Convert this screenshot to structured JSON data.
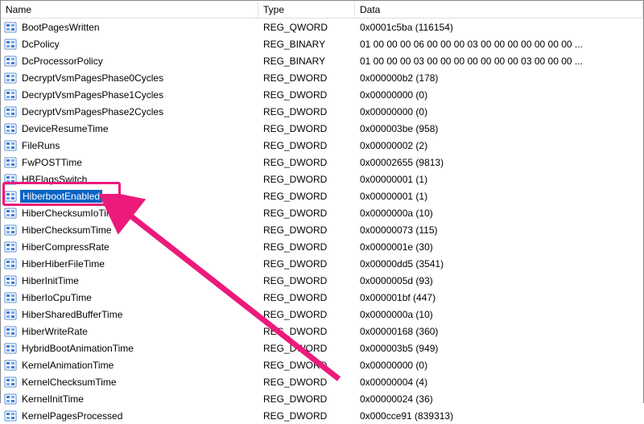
{
  "columns": {
    "name": "Name",
    "type": "Type",
    "data": "Data"
  },
  "rows": [
    {
      "name": "BootPagesWritten",
      "type": "REG_QWORD",
      "data": "0x0001c5ba (116154)"
    },
    {
      "name": "DcPolicy",
      "type": "REG_BINARY",
      "data": "01 00 00 00 06 00 00 00 03 00 00 00 00 00 00 00 ..."
    },
    {
      "name": "DcProcessorPolicy",
      "type": "REG_BINARY",
      "data": "01 00 00 00 03 00 00 00 00 00 00 00 03 00 00 00 ..."
    },
    {
      "name": "DecryptVsmPagesPhase0Cycles",
      "type": "REG_DWORD",
      "data": "0x000000b2 (178)"
    },
    {
      "name": "DecryptVsmPagesPhase1Cycles",
      "type": "REG_DWORD",
      "data": "0x00000000 (0)"
    },
    {
      "name": "DecryptVsmPagesPhase2Cycles",
      "type": "REG_DWORD",
      "data": "0x00000000 (0)"
    },
    {
      "name": "DeviceResumeTime",
      "type": "REG_DWORD",
      "data": "0x000003be (958)"
    },
    {
      "name": "FileRuns",
      "type": "REG_DWORD",
      "data": "0x00000002 (2)"
    },
    {
      "name": "FwPOSTTime",
      "type": "REG_DWORD",
      "data": "0x00002655 (9813)"
    },
    {
      "name": "HBFlagsSwitch",
      "type": "REG_DWORD",
      "data": "0x00000001 (1)"
    },
    {
      "name": "HiberbootEnabled",
      "type": "REG_DWORD",
      "data": "0x00000001 (1)",
      "selected": true
    },
    {
      "name": "HiberChecksumIoTime",
      "type": "REG_DWORD",
      "data": "0x0000000a (10)"
    },
    {
      "name": "HiberChecksumTime",
      "type": "REG_DWORD",
      "data": "0x00000073 (115)"
    },
    {
      "name": "HiberCompressRate",
      "type": "REG_DWORD",
      "data": "0x0000001e (30)"
    },
    {
      "name": "HiberHiberFileTime",
      "type": "REG_DWORD",
      "data": "0x00000dd5 (3541)"
    },
    {
      "name": "HiberInitTime",
      "type": "REG_DWORD",
      "data": "0x0000005d (93)"
    },
    {
      "name": "HiberIoCpuTime",
      "type": "REG_DWORD",
      "data": "0x000001bf (447)"
    },
    {
      "name": "HiberSharedBufferTime",
      "type": "REG_DWORD",
      "data": "0x0000000a (10)"
    },
    {
      "name": "HiberWriteRate",
      "type": "REG_DWORD",
      "data": "0x00000168 (360)"
    },
    {
      "name": "HybridBootAnimationTime",
      "type": "REG_DWORD",
      "data": "0x000003b5 (949)"
    },
    {
      "name": "KernelAnimationTime",
      "type": "REG_DWORD",
      "data": "0x00000000 (0)"
    },
    {
      "name": "KernelChecksumTime",
      "type": "REG_DWORD",
      "data": "0x00000004 (4)"
    },
    {
      "name": "KernelInitTime",
      "type": "REG_DWORD",
      "data": "0x00000024 (36)"
    },
    {
      "name": "KernelPagesProcessed",
      "type": "REG_DWORD",
      "data": "0x000cce91 (839313)"
    }
  ],
  "annotation": {
    "highlight_row_index": 10,
    "highlight_color": "#ec1a7a"
  }
}
